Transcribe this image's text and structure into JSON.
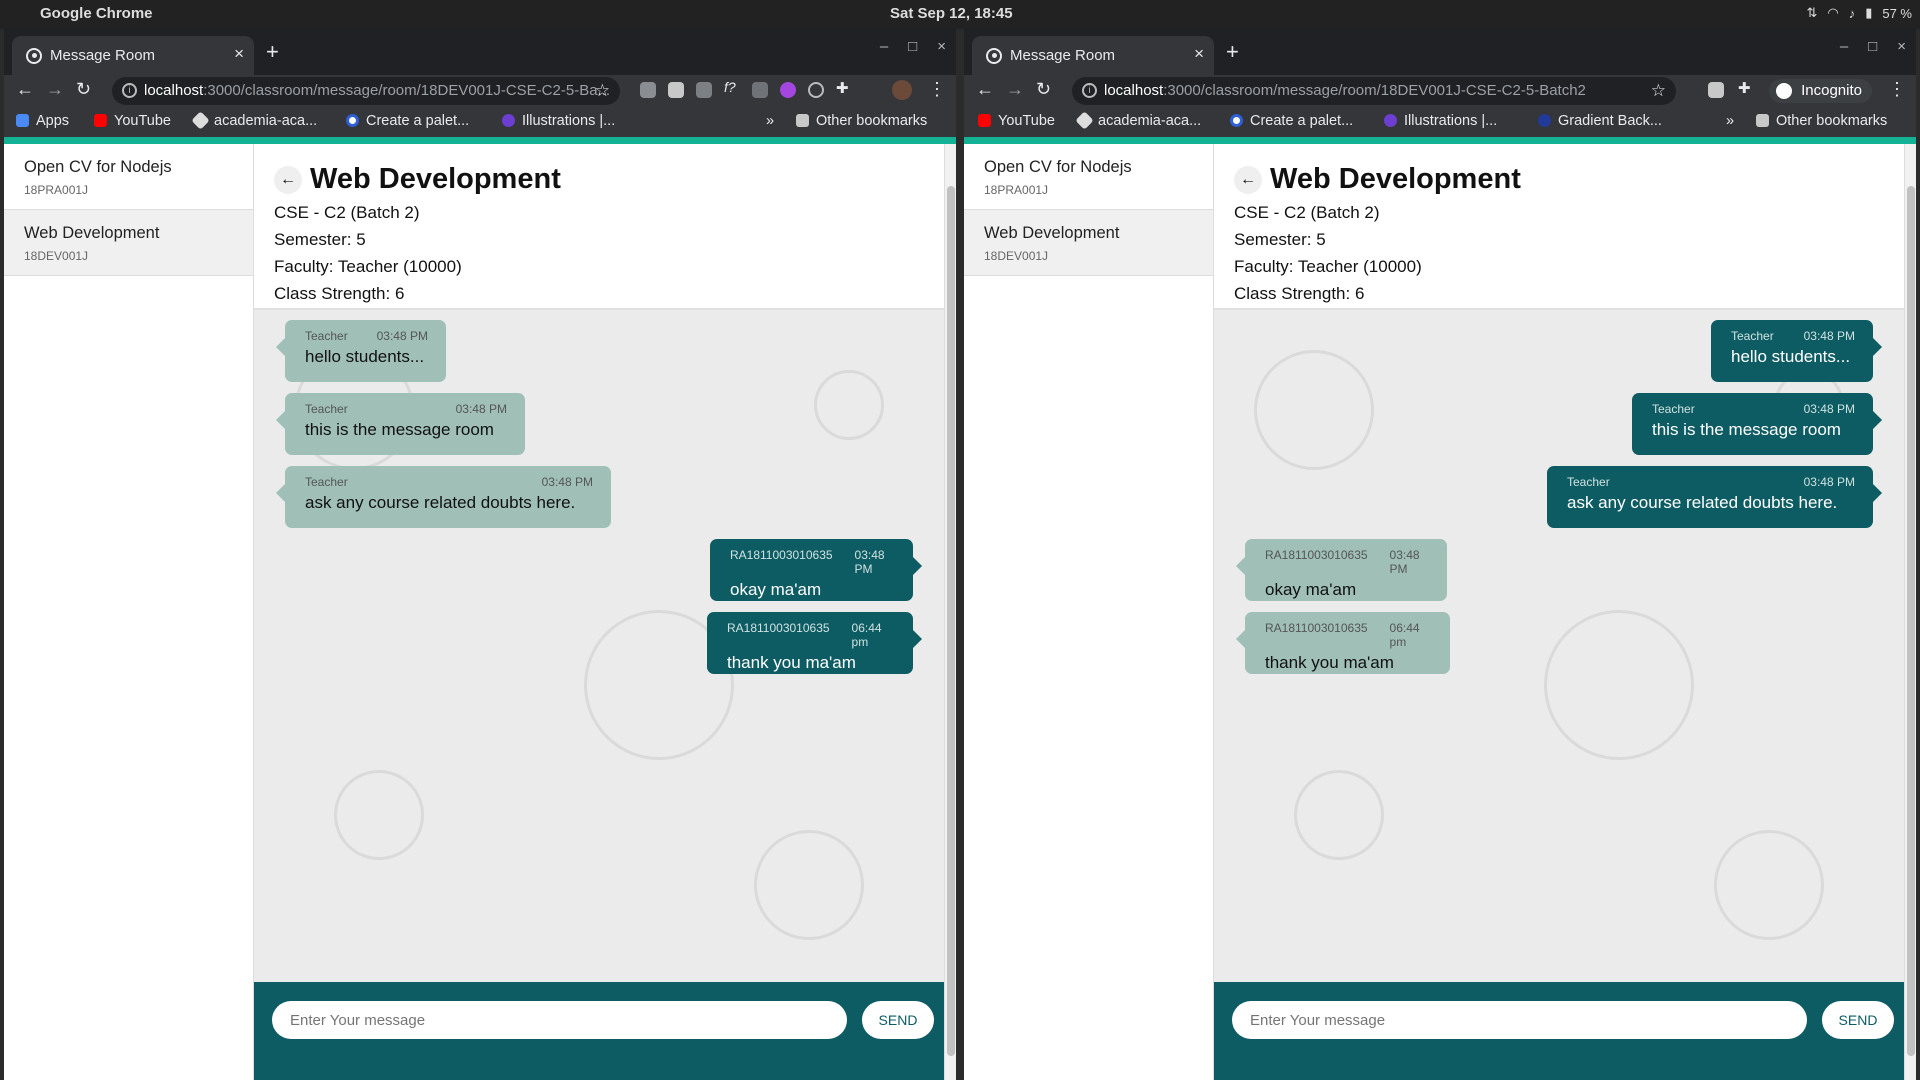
{
  "system": {
    "app": "Google Chrome",
    "clock": "Sat Sep 12, 18:45",
    "battery": "57 %"
  },
  "colors": {
    "accent": "#12b394",
    "teal": "#0e5c63",
    "incoming_bubble": "#9fbfb7"
  },
  "windows": [
    {
      "tab_title": "Message Room",
      "url_host": "localhost",
      "url_path": ":3000/classroom/message/room/18DEV001J-CSE-C2-5-Ba...",
      "bookmarks": [
        "Apps",
        "YouTube",
        "academia-aca...",
        "Create a palet...",
        "Illustrations |...",
        "»",
        "Other bookmarks"
      ],
      "sidebar": [
        {
          "name": "Open CV for Nodejs",
          "code": "18PRA001J"
        },
        {
          "name": "Web Development",
          "code": "18DEV001J"
        }
      ],
      "header": {
        "back_icon": "←",
        "title": "Web Development",
        "batch": "CSE - C2 (Batch 2)",
        "semester": "Semester: 5",
        "faculty": "Faculty: Teacher (10000)",
        "strength": "Class Strength: 6"
      },
      "messages": [
        {
          "sender": "Teacher",
          "time": "03:48 PM",
          "text": "hello students...",
          "dir": "in"
        },
        {
          "sender": "Teacher",
          "time": "03:48 PM",
          "text": "this is the message room",
          "dir": "in"
        },
        {
          "sender": "Teacher",
          "time": "03:48 PM",
          "text": "ask any course related doubts here.",
          "dir": "in"
        },
        {
          "sender": "RA1811003010635",
          "time": "03:48 PM",
          "text": "okay ma'am",
          "dir": "out"
        },
        {
          "sender": "RA1811003010635",
          "time": "06:44 pm",
          "text": "thank you ma'am",
          "dir": "out"
        }
      ],
      "composer": {
        "placeholder": "Enter Your message",
        "send": "SEND"
      }
    },
    {
      "tab_title": "Message Room",
      "url_host": "localhost",
      "url_path": ":3000/classroom/message/room/18DEV001J-CSE-C2-5-Batch2",
      "incognito": "Incognito",
      "bookmarks": [
        "YouTube",
        "academia-aca...",
        "Create a palet...",
        "Illustrations |...",
        "Gradient Back...",
        "»",
        "Other bookmarks"
      ],
      "sidebar": [
        {
          "name": "Open CV for Nodejs",
          "code": "18PRA001J"
        },
        {
          "name": "Web Development",
          "code": "18DEV001J"
        }
      ],
      "header": {
        "back_icon": "←",
        "title": "Web Development",
        "batch": "CSE - C2 (Batch 2)",
        "semester": "Semester: 5",
        "faculty": "Faculty: Teacher (10000)",
        "strength": "Class Strength: 6"
      },
      "messages": [
        {
          "sender": "Teacher",
          "time": "03:48 PM",
          "text": "hello students...",
          "dir": "out"
        },
        {
          "sender": "Teacher",
          "time": "03:48 PM",
          "text": "this is the message room",
          "dir": "out"
        },
        {
          "sender": "Teacher",
          "time": "03:48 PM",
          "text": "ask any course related doubts here.",
          "dir": "out"
        },
        {
          "sender": "RA1811003010635",
          "time": "03:48 PM",
          "text": "okay ma'am",
          "dir": "in"
        },
        {
          "sender": "RA1811003010635",
          "time": "06:44 pm",
          "text": "thank you ma'am",
          "dir": "in"
        }
      ],
      "composer": {
        "placeholder": "Enter Your message",
        "send": "SEND"
      }
    }
  ]
}
